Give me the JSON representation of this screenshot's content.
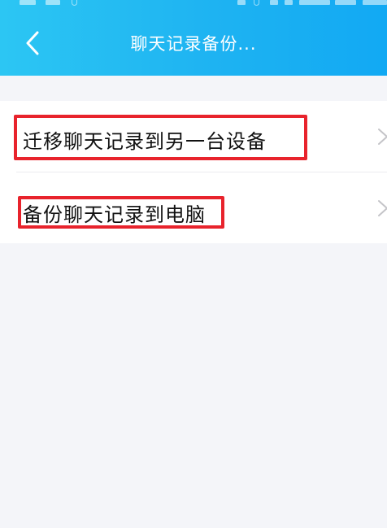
{
  "header": {
    "title": "聊天记录备份...",
    "back_icon": "chevron-left-icon"
  },
  "menu": {
    "items": [
      {
        "label": "迁移聊天记录到另一台设备",
        "icon": "chevron-right-icon"
      },
      {
        "label": "备份聊天记录到电脑",
        "icon": "chevron-right-icon"
      }
    ]
  },
  "colors": {
    "header_start": "#2cc6f3",
    "header_end": "#12a9f3",
    "highlight": "#e8232c",
    "background": "#f4f5f9"
  }
}
